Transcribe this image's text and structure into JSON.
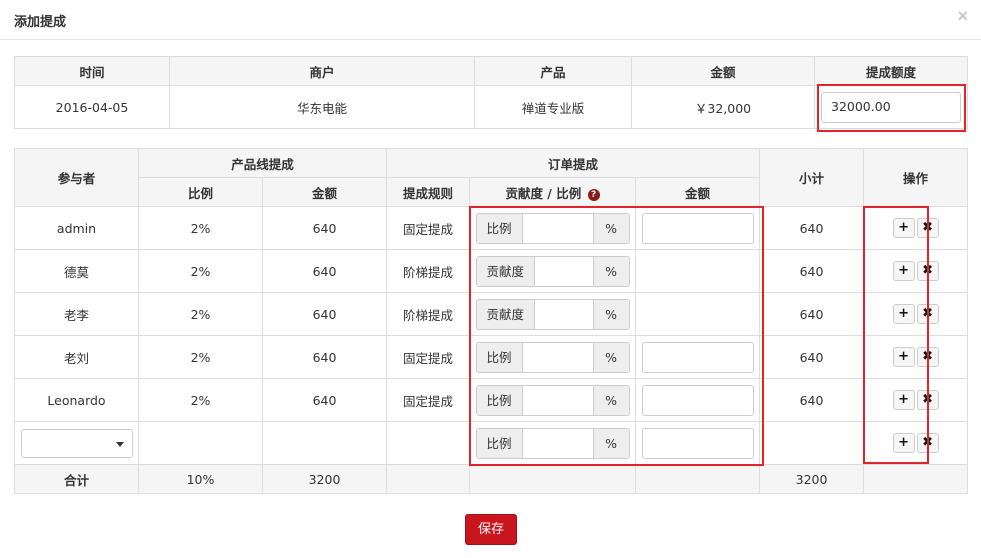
{
  "modal": {
    "title": "添加提成",
    "close_label": "×"
  },
  "summary": {
    "headers": [
      "时间",
      "商户",
      "产品",
      "金额",
      "提成额度"
    ],
    "row": {
      "date": "2016-04-05",
      "merchant": "华东电能",
      "product": "禅道专业版",
      "amount": "￥32,000",
      "commission_quota": "32000.00"
    }
  },
  "main": {
    "headers": {
      "participant": "参与者",
      "product_line": "产品线提成",
      "order": "订单提成",
      "subtotal": "小计",
      "actions": "操作",
      "ratio": "比例",
      "amount": "金额",
      "rule": "提成规则",
      "contribution_ratio": "贡献度 / 比例",
      "order_amount": "金额"
    },
    "rows": [
      {
        "name": "admin",
        "ratio": "2%",
        "amount": "640",
        "rule": "固定提成",
        "input_label": "比例",
        "suffix": "%",
        "subtotal": "640"
      },
      {
        "name": "德莫",
        "ratio": "2%",
        "amount": "640",
        "rule": "阶梯提成",
        "input_label": "贡献度",
        "suffix": "%",
        "subtotal": "640"
      },
      {
        "name": "老李",
        "ratio": "2%",
        "amount": "640",
        "rule": "阶梯提成",
        "input_label": "贡献度",
        "suffix": "%",
        "subtotal": "640"
      },
      {
        "name": "老刘",
        "ratio": "2%",
        "amount": "640",
        "rule": "固定提成",
        "input_label": "比例",
        "suffix": "%",
        "subtotal": "640"
      },
      {
        "name": "Leonardo",
        "ratio": "2%",
        "amount": "640",
        "rule": "固定提成",
        "input_label": "比例",
        "suffix": "%",
        "subtotal": "640"
      }
    ],
    "new_row": {
      "input_label": "比例",
      "suffix": "%"
    },
    "total": {
      "label": "合计",
      "ratio": "10%",
      "amount": "3200",
      "subtotal": "3200"
    },
    "add_icon": "+",
    "remove_icon": "✖",
    "help_icon": "?"
  },
  "save_label": "保存",
  "colors": {
    "highlight": "#e0242a",
    "save_button": "#c9151e"
  }
}
